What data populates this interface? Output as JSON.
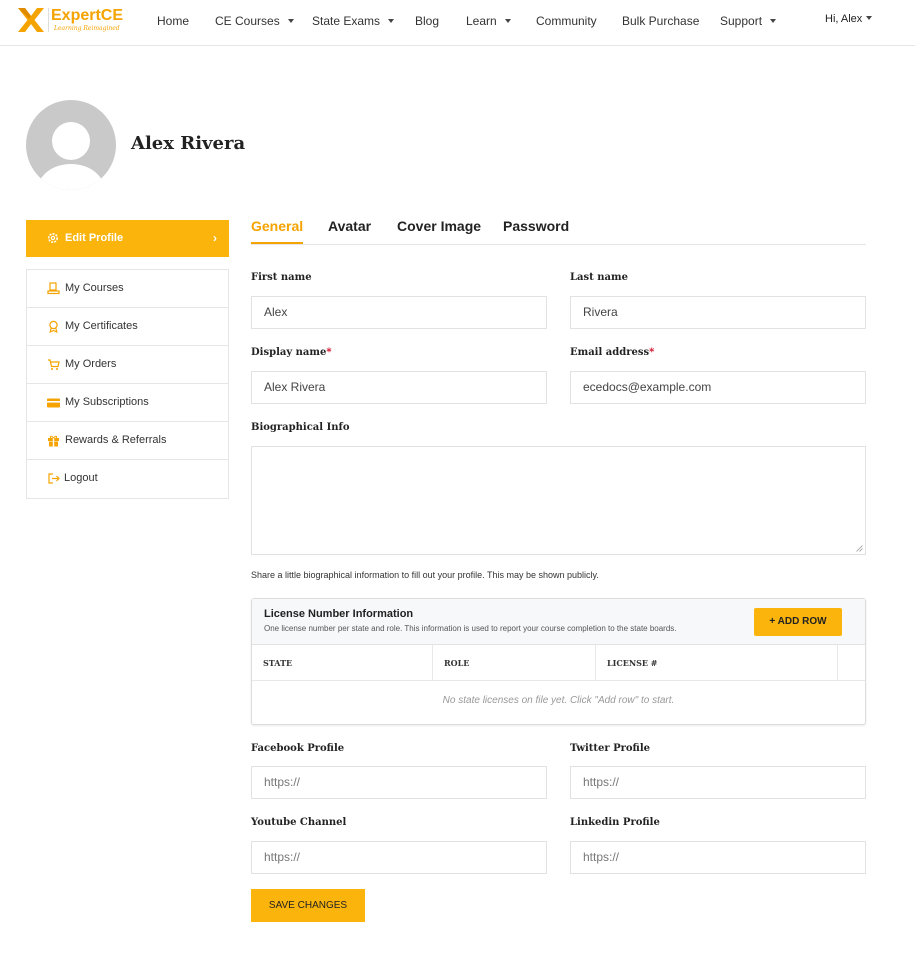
{
  "header": {
    "brand_name": "ExpertCE",
    "brand_tagline": "Learning Reimagined",
    "nav": [
      {
        "label": "Home",
        "has_caret": false
      },
      {
        "label": "CE Courses",
        "has_caret": true
      },
      {
        "label": "State Exams",
        "has_caret": true
      },
      {
        "label": "Blog",
        "has_caret": false
      },
      {
        "label": "Learn",
        "has_caret": true
      },
      {
        "label": "Community",
        "has_caret": false
      },
      {
        "label": "Bulk Purchase",
        "has_caret": false
      },
      {
        "label": "Support",
        "has_caret": true
      }
    ],
    "greeting": "Hi, Alex"
  },
  "profile": {
    "name": "Alex Rivera"
  },
  "sidebar": {
    "active_item": {
      "label": "Edit Profile",
      "icon": "gear-icon"
    },
    "items": [
      {
        "label": "My Courses",
        "icon": "course-icon"
      },
      {
        "label": "My Certificates",
        "icon": "certificate-icon"
      },
      {
        "label": "My Orders",
        "icon": "cart-icon"
      },
      {
        "label": "My Subscriptions",
        "icon": "card-icon"
      },
      {
        "label": "Rewards & Referrals",
        "icon": "gift-icon"
      },
      {
        "label": "Logout",
        "icon": "logout-icon"
      }
    ]
  },
  "tabs": [
    "General",
    "Avatar",
    "Cover Image",
    "Password"
  ],
  "form": {
    "first_name": {
      "label": "First name",
      "value": "Alex"
    },
    "last_name": {
      "label": "Last name",
      "value": "Rivera"
    },
    "display_name": {
      "label": "Display name",
      "required_mark": "*",
      "value": "Alex Rivera"
    },
    "email": {
      "label": "Email address",
      "required_mark": "*",
      "value": "ecedocs@example.com"
    },
    "bio": {
      "label": "Biographical Info",
      "value": "",
      "help": "Share a little biographical information to fill out your profile. This may be shown publicly."
    },
    "facebook": {
      "label": "Facebook Profile",
      "placeholder": "https://"
    },
    "twitter": {
      "label": "Twitter Profile",
      "placeholder": "https://"
    },
    "youtube": {
      "label": "Youtube Channel",
      "placeholder": "https://"
    },
    "linkedin": {
      "label": "Linkedin Profile",
      "placeholder": "https://"
    },
    "save_label": "SAVE CHANGES"
  },
  "license": {
    "title": "License Number Information",
    "subtitle": "One license number per state and role. This information is used to report your course completion to the state boards.",
    "add_row_label": "+ ADD ROW",
    "columns": [
      "STATE",
      "ROLE",
      "LICENSE #"
    ],
    "empty_message": "No state licenses on file yet. Click \"Add row\" to start."
  },
  "colors": {
    "accent": "#fbb40c",
    "accent_text": "#f5a300",
    "required": "#d0021b"
  }
}
